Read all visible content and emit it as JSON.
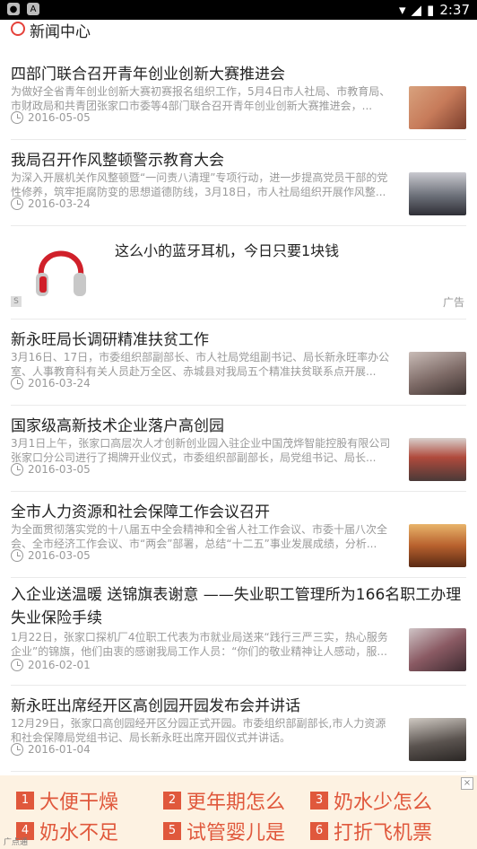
{
  "statusbar": {
    "time": "2:37",
    "icons": [
      "wechat-icon",
      "a-icon",
      "wifi-icon",
      "signal-icon",
      "battery-icon"
    ]
  },
  "header": {
    "title": "新闻中心"
  },
  "news": [
    {
      "title": "四部门联合召开青年创业创新大赛推进会",
      "desc": "为做好全省青年创业创新大赛初赛报名组织工作，5月4日市人社局、市教育局、市财政局和共青团张家口市委等4部门联合召开青年创业创新大赛推进会，...",
      "date": "2016-05-05",
      "thumb_color": "#c77b5a"
    },
    {
      "title": "我局召开作风整顿警示教育大会",
      "desc": "为深入开展机关作风整顿暨“一问责八清理”专项行动，进一步提高党员干部的党性修养，筑牢拒腐防变的思想道德防线，3月18日，市人社局组织开展作风整...",
      "date": "2016-03-24",
      "thumb_color": "#6b6f78"
    }
  ],
  "ad": {
    "title": "这么小的蓝牙耳机，今日只要1块钱",
    "tag": "广告",
    "badge": "S"
  },
  "news2": [
    {
      "title": "新永旺局长调研精准扶贫工作",
      "desc": "3月16日、17日，市委组织部副部长、市人社局党组副书记、局长新永旺率办公室、人事教育科有关人员赴万全区、赤城县对我局五个精准扶贫联系点开展...",
      "date": "2016-03-24",
      "thumb_color": "#7d6a66"
    },
    {
      "title": "国家级高新技术企业落户高创园",
      "desc": "3月1日上午，张家口高层次人才创新创业园入驻企业中国茂烨智能控股有限公司张家口分公司进行了揭牌开业仪式，市委组织部副部长，局党组书记、局长...",
      "date": "2016-03-05",
      "thumb_color": "#b04a3c"
    },
    {
      "title": "全市人力资源和社会保障工作会议召开",
      "desc": "为全面贯彻落实党的十八届五中全会精神和全省人社工作会议、市委十届八次全会、全市经济工作会议、市“两会”部署，总结“十二五”事业发展成绩，分析...",
      "date": "2016-03-05",
      "thumb_color": "#b8612e"
    }
  ],
  "news_tall": {
    "title": "入企业送温暖 送锦旗表谢意 ——失业职工管理所为166名职工办理失业保险手续",
    "desc": "1月22日，张家口探机厂4位职工代表为市就业局送来“践行三严三实，热心服务企业”的锦旗，他们由衷的感谢我局工作人员：“你们的敬业精神让人感动，服...",
    "date": "2016-02-01",
    "thumb_color": "#8a5a63"
  },
  "news3": [
    {
      "title": "新永旺出席经开区高创园开园发布会并讲话",
      "desc": "12月29日，张家口高创园经开区分园正式开园。市委组织部副部长,市人力资源和社会保障局党组书记、局长新永旺出席开园仪式并讲话。",
      "date": "2016-01-04",
      "thumb_color": "#5b5450"
    }
  ],
  "banner": {
    "close": "×",
    "items": [
      {
        "num": "1",
        "text": "大便干燥"
      },
      {
        "num": "2",
        "text": "更年期怎么"
      },
      {
        "num": "3",
        "text": "奶水少怎么"
      },
      {
        "num": "4",
        "text": "奶水不足"
      },
      {
        "num": "5",
        "text": "试管婴儿是"
      },
      {
        "num": "6",
        "text": "打折飞机票"
      }
    ],
    "source": "广点通"
  }
}
